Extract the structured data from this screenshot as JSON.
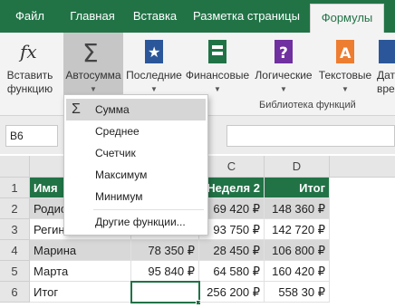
{
  "tabs": [
    {
      "label": "Файл"
    },
    {
      "label": "Главная"
    },
    {
      "label": "Вставка"
    },
    {
      "label": "Разметка страницы"
    },
    {
      "label": "Формулы"
    }
  ],
  "ribbon": {
    "insert_function": {
      "line1": "Вставить",
      "line2": "функцию",
      "icon": "fx-icon"
    },
    "autosum": {
      "label": "Автосумма",
      "icon": "sigma-icon"
    },
    "recent": {
      "label": "Последние",
      "icon": "star-book-icon"
    },
    "financial": {
      "label": "Финансовые",
      "icon": "finance-book-icon"
    },
    "logical": {
      "label": "Логические",
      "icon": "question-book-icon"
    },
    "text": {
      "label": "Текстовые",
      "icon": "text-book-icon"
    },
    "datetime": {
      "line1": "Дат",
      "line2": "врем"
    },
    "group_label": "Библиотека функций"
  },
  "namebox": {
    "value": "B6"
  },
  "menu": {
    "items": [
      {
        "label": "Сумма"
      },
      {
        "label": "Среднее"
      },
      {
        "label": "Счетчик"
      },
      {
        "label": "Максимум"
      },
      {
        "label": "Минимум"
      },
      {
        "label": "Другие функции..."
      }
    ],
    "sigma": "Σ"
  },
  "sheet": {
    "columns": [
      "C",
      "D"
    ],
    "rows": [
      "1",
      "2",
      "3",
      "4",
      "5",
      "6"
    ],
    "colA": [
      "Имя",
      "Родио",
      "Регина",
      "Марина",
      "Марта",
      "Итог"
    ],
    "colB": [
      "",
      "",
      "",
      "78 350 ₽",
      "95 840 ₽",
      ""
    ],
    "colC": [
      "Неделя 2",
      "69 420 ₽",
      "93 750 ₽",
      "28 450 ₽",
      "64 580 ₽",
      "256 200 ₽"
    ],
    "colD": [
      "Итог",
      "148 360 ₽",
      "142 720 ₽",
      "106 800 ₽",
      "160 420 ₽",
      "558 30 ₽"
    ]
  },
  "colors": {
    "accent": "#217346",
    "band": "#d8d8d8"
  }
}
